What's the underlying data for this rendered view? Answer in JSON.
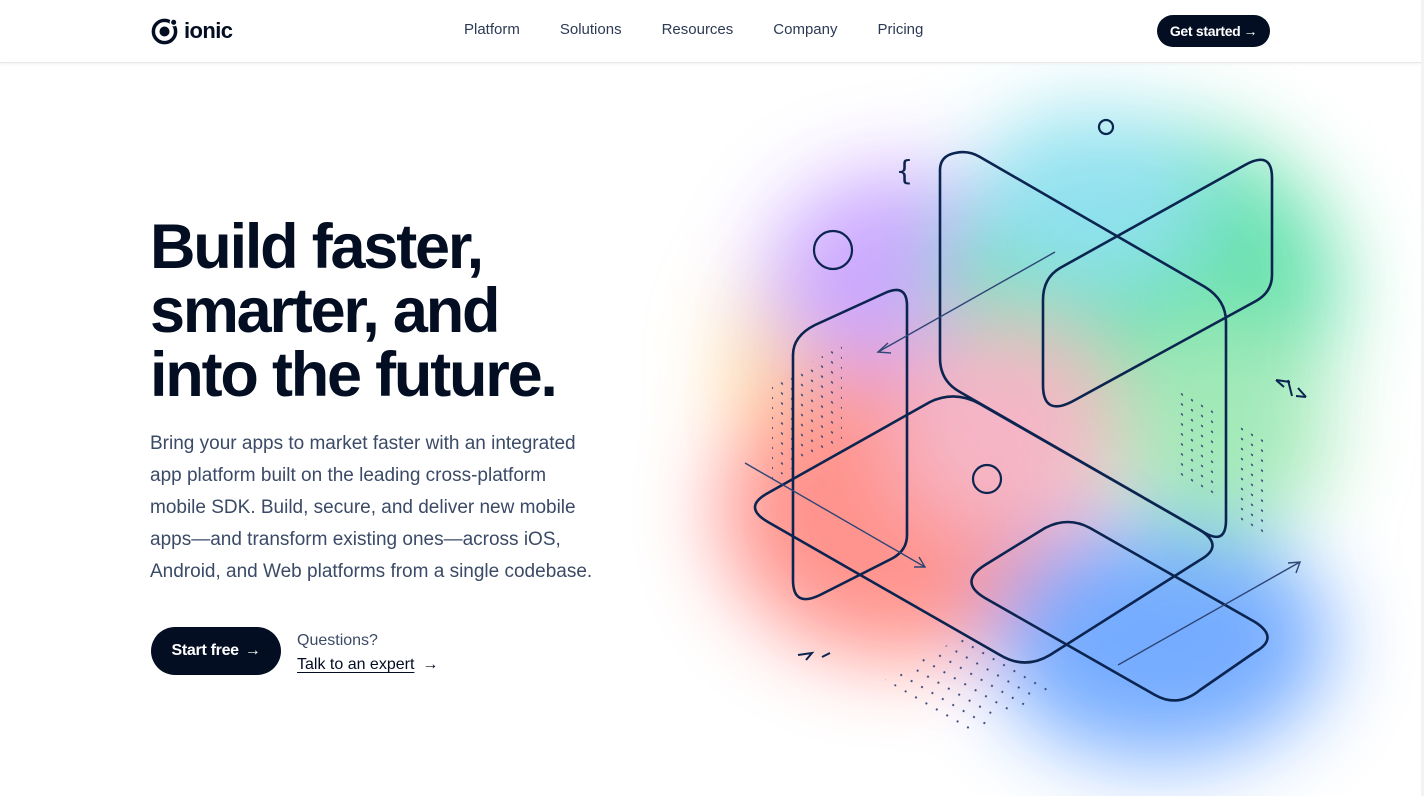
{
  "brand": {
    "name": "ionic",
    "icon": "ionic-logo-icon",
    "color": "#030e23"
  },
  "nav": {
    "links": [
      "Platform",
      "Solutions",
      "Resources",
      "Company",
      "Pricing"
    ],
    "cta_label": "Get started",
    "cta_arrow": "→"
  },
  "hero": {
    "title_lines": [
      "Build faster,",
      "smarter, and",
      "into the future."
    ],
    "subtitle_lines": [
      "Bring your apps to market faster with an integrated",
      "app platform built on the leading cross-platform",
      "mobile SDK. Build, secure, and deliver new mobile",
      "apps—and transform existing ones—across iOS,",
      "Android, and Web platforms from a single codebase."
    ],
    "primary_button": {
      "label": "Start free",
      "arrow": "→"
    },
    "questions_text": "Questions?",
    "expert_link": {
      "label": "Talk to an expert",
      "arrow": "→"
    }
  },
  "illustration": {
    "glyphs": {
      "brace": "{",
      "code": "</>"
    },
    "colors": {
      "stroke": "#0b2450",
      "green": "#5ee0a8",
      "blue": "#6ea8ff",
      "coral": "#ff8d86",
      "purple": "#c9a4ff",
      "yellow": "#ffd88a"
    }
  }
}
